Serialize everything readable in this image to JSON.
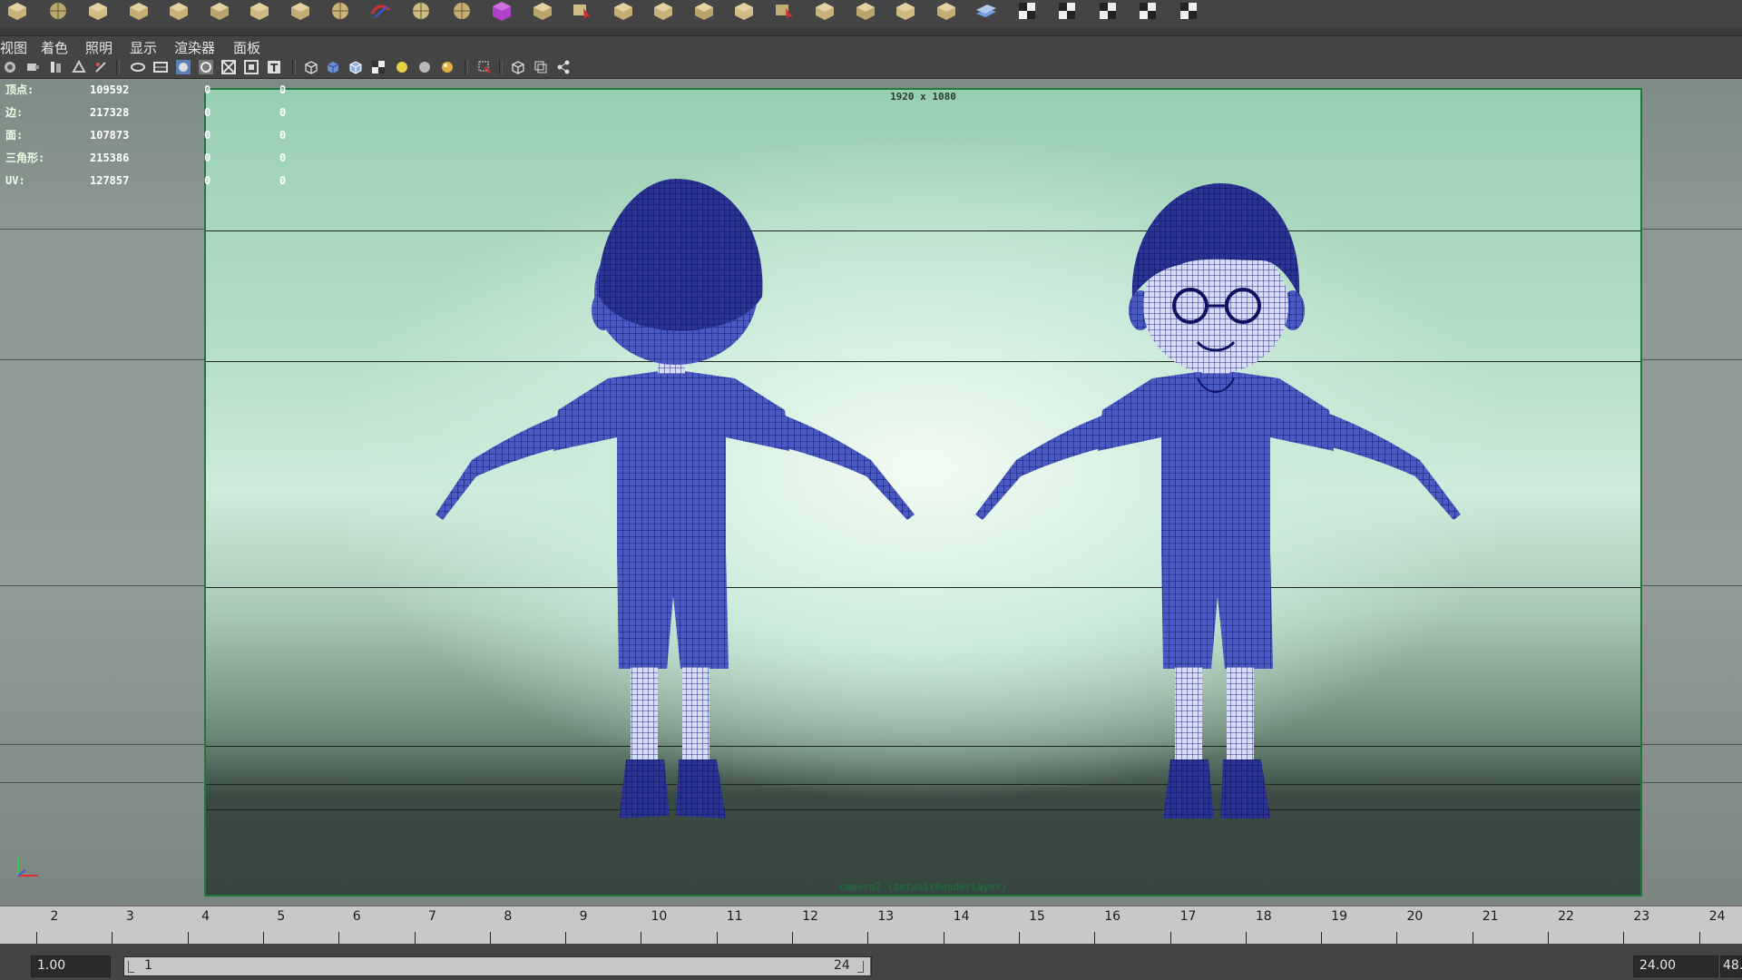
{
  "panel_menu": {
    "items": [
      "视图",
      "着色",
      "照明",
      "显示",
      "渲染器",
      "面板"
    ]
  },
  "hud": {
    "rows": [
      {
        "label": "顶点:",
        "v1": "109592",
        "v2": "0",
        "v3": "0"
      },
      {
        "label": "边:",
        "v1": "217328",
        "v2": "0",
        "v3": "0"
      },
      {
        "label": "面:",
        "v1": "107873",
        "v2": "0",
        "v3": "0"
      },
      {
        "label": "三角形:",
        "v1": "215386",
        "v2": "0",
        "v3": "0"
      },
      {
        "label": "UV:",
        "v1": "127857",
        "v2": "0",
        "v3": "0"
      }
    ]
  },
  "viewport": {
    "resolution": "1920 x 1080",
    "camera": "camera2 (defaultRenderLayer)"
  },
  "timeline": {
    "ticks": [
      "2",
      "3",
      "4",
      "5",
      "6",
      "7",
      "8",
      "9",
      "10",
      "11",
      "12",
      "13",
      "14",
      "15",
      "16",
      "17",
      "18",
      "19",
      "20",
      "21",
      "22",
      "23",
      "24"
    ]
  },
  "range": {
    "start": "1.00",
    "slider_start": "1",
    "slider_end": "24",
    "end": "24.00",
    "anim_end": "48."
  },
  "colors": {
    "resolution_gate": "#1e7a3c",
    "mesh_wire": "#1b1f8a",
    "mesh_fill": "#5566cc"
  },
  "icons": {
    "shelf": [
      "cube-icon",
      "sphere-icon",
      "cylinder-icon",
      "cone-icon",
      "plane-icon",
      "torus-icon",
      "pyramid-icon",
      "pipe-icon",
      "soccer-ball-icon",
      "twist-icon",
      "sphere-icon",
      "sphere-icon",
      "cube-magenta-icon",
      "plane-icon",
      "arrow-select-icon",
      "plane-icon",
      "card-icon",
      "diamond-icon",
      "cards-icon",
      "arrow-select-icon",
      "cards-icon",
      "cards-icon",
      "gem-icon",
      "card-icon",
      "layers-icon",
      "checker-icon",
      "checker-icon",
      "checker-icon",
      "checker-ball-icon",
      "checker-frame-icon"
    ]
  }
}
